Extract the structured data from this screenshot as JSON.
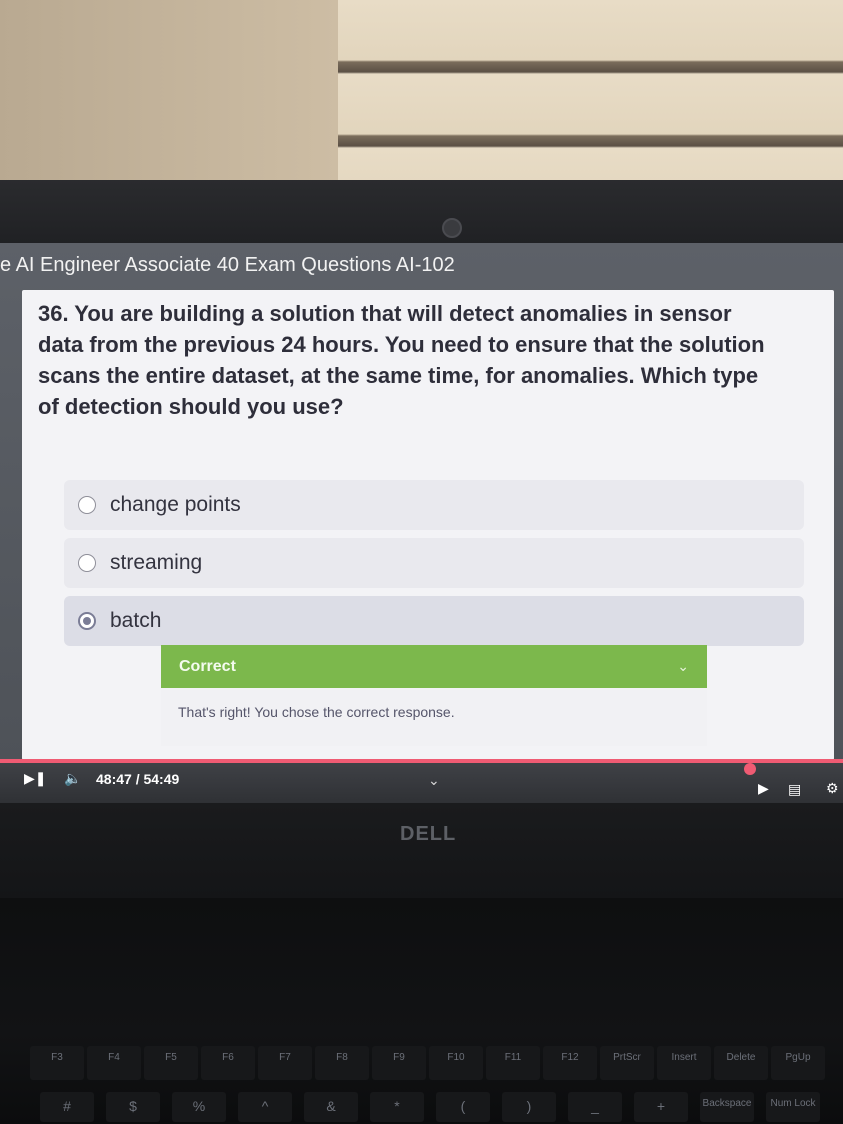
{
  "course": {
    "title": "e AI Engineer Associate 40 Exam Questions AI-102"
  },
  "question": {
    "text": "36. You are building a solution that will detect anomalies in sensor data from the previous 24 hours. You need to ensure that the solution scans the entire dataset, at the same time, for anomalies. Which type of detection should you use?",
    "options": [
      {
        "label": "change points",
        "selected": false
      },
      {
        "label": "streaming",
        "selected": false
      },
      {
        "label": "batch",
        "selected": true
      }
    ]
  },
  "feedback": {
    "title": "Correct",
    "message": "That's right! You chose the correct response."
  },
  "player": {
    "time": "48:47 / 54:49",
    "progress_fraction": 0.89,
    "accent_color": "#ef5b73"
  },
  "device": {
    "brand": "DELL"
  },
  "keyboard": {
    "function_row": [
      "F3",
      "F4",
      "F5",
      "F6",
      "F7",
      "F8",
      "F9",
      "F10",
      "F11",
      "F12",
      "PrtScr",
      "Insert",
      "Delete",
      "PgUp"
    ],
    "number_row": [
      "#",
      "$",
      "%",
      "^",
      "&",
      "*",
      "(",
      ")",
      "_",
      "+",
      "Backspace",
      "Num Lock"
    ]
  },
  "colors": {
    "correct_green": "#7cb84c",
    "panel_bg": "#f3f3f6"
  }
}
